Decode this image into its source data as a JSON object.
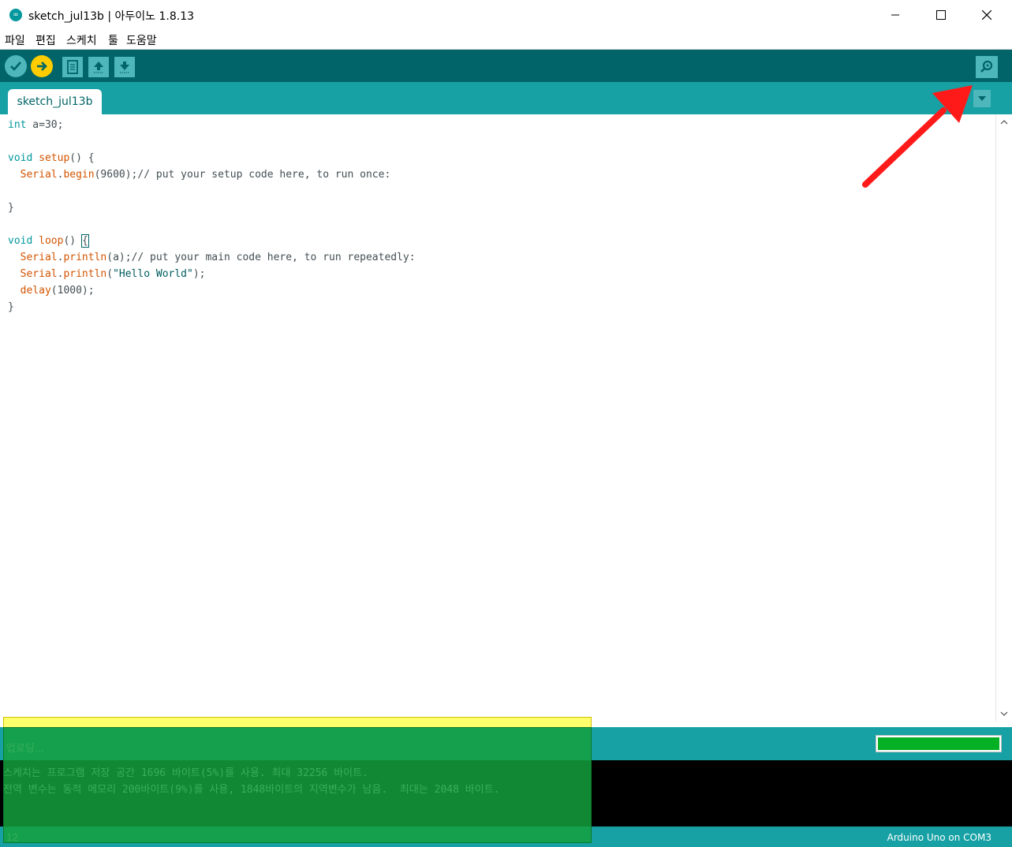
{
  "window": {
    "title": "sketch_jul13b | 아두이노 1.8.13",
    "app_icon": "arduino-logo-icon",
    "controls": {
      "minimize": "—",
      "maximize": "☐",
      "close": "✕"
    }
  },
  "menu": [
    "파일",
    "편집",
    "스케치",
    "툴",
    "도움말"
  ],
  "toolbar": {
    "buttons": [
      "verify-icon",
      "upload-icon",
      "new-icon",
      "open-icon",
      "save-icon"
    ],
    "serial_monitor": "serial-monitor-icon"
  },
  "tabs": [
    {
      "label": "sketch_jul13b"
    }
  ],
  "editor": {
    "lines": [
      "int a=30;",
      "",
      "void setup() {",
      "  Serial.begin(9600);// put your setup code here, to run once:",
      "",
      "}",
      "",
      "void loop() {",
      "  Serial.println(a);// put your main code here, to run repeatedly:",
      "  Serial.println(\"Hello World\");",
      "  delay(1000);",
      "}"
    ]
  },
  "status": {
    "message": "업로딩...",
    "progress": 1.0
  },
  "console": {
    "line1": "스케치는 프로그램 저장 공간 1696 바이트(5%)를 사용. 최대 32256 바이트.",
    "line2": "전역 변수는 동적 메모리 200바이트(9%)를 사용, 1848바이트의 지역변수가 남음.  최대는 2048 바이트."
  },
  "footer": {
    "line_number": "12",
    "board": "Arduino Uno on COM3"
  },
  "colors": {
    "toolbar_bg": "#006468",
    "tab_bg": "#17a1a5",
    "keyword": "#00979c",
    "function": "#d35400",
    "annotation_arrow": "#ff1a1a"
  }
}
